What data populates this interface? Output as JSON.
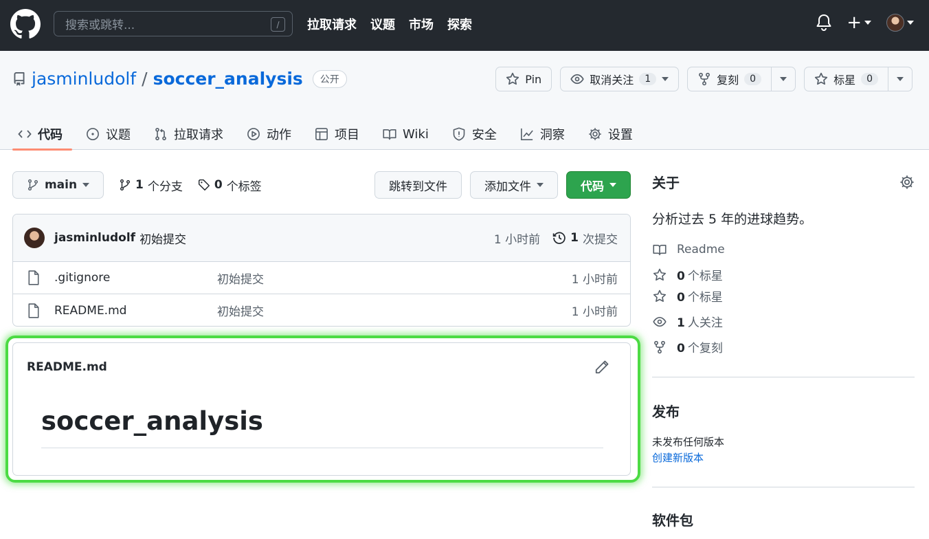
{
  "topbar": {
    "search_placeholder": "搜索或跳转...",
    "search_shortcut": "/",
    "nav": [
      "拉取请求",
      "议题",
      "市场",
      "探索"
    ],
    "plus_label": "+"
  },
  "repo": {
    "owner": "jasminludolf",
    "separator": "/",
    "name": "soccer_analysis",
    "visibility": "公开",
    "actions": {
      "pin_label": "Pin",
      "watch_label": "取消关注",
      "watch_count": "1",
      "fork_label": "复刻",
      "fork_count": "0",
      "star_label": "标星",
      "star_count": "0"
    },
    "tabs": [
      "代码",
      "议题",
      "拉取请求",
      "动作",
      "项目",
      "Wiki",
      "安全",
      "洞察",
      "设置"
    ]
  },
  "code": {
    "branch": "main",
    "branches_count": "1",
    "branches_label": "个分支",
    "tags_count": "0",
    "tags_label": "个标签",
    "goto_file": "跳转到文件",
    "add_file": "添加文件",
    "code_button": "代码",
    "latest_commit": {
      "author": "jasminludolf",
      "message": "初始提交",
      "time": "1 小时前",
      "commits_count": "1",
      "commits_label": "次提交"
    },
    "files": [
      {
        "name": ".gitignore",
        "message": "初始提交",
        "time": "1 小时前"
      },
      {
        "name": "README.md",
        "message": "初始提交",
        "time": "1 小时前"
      }
    ]
  },
  "readme": {
    "filename": "README.md",
    "heading": "soccer_analysis"
  },
  "sidebar": {
    "about_title": "关于",
    "description": "分析过去 5 年的进球趋势。",
    "readme_label": "Readme",
    "stars_1": {
      "count": "0",
      "label": "个标星"
    },
    "stars_2": {
      "count": "0",
      "label": "个标星"
    },
    "watchers": {
      "count": "1",
      "label": "人关注"
    },
    "forks": {
      "count": "0",
      "label": "个复刻"
    },
    "releases_title": "发布",
    "releases_desc": "未发布任何版本",
    "releases_link": "创建新版本",
    "packages_title": "软件包"
  },
  "colors": {
    "topbar_bg": "#24292f",
    "link_blue": "#0969da",
    "green_button": "#2da44e",
    "tab_underline": "#fd8c73",
    "highlight_green": "#4cdb44"
  }
}
